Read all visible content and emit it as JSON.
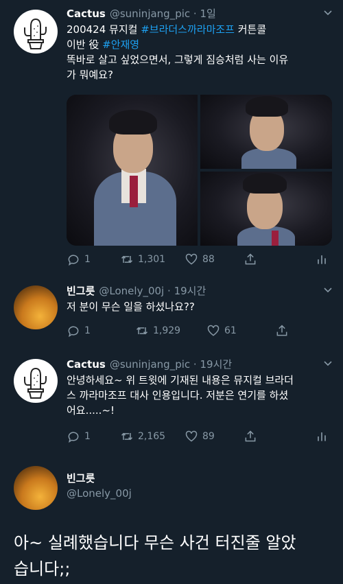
{
  "tweet1": {
    "name": "Cactus",
    "handle": "@suninjang_pic",
    "dot": "·",
    "time": "1일",
    "line1_pre": "200424 뮤지컬 ",
    "line1_tag": "#브라더스까라마조프",
    "line1_post": " 커튼콜",
    "line2_pre": "이반 役 ",
    "line2_tag": "#안재영",
    "line3": "똑바로 살고 싶었으면서, 그렇게 짐승처럼 사는 이유",
    "line4": "가 뭐예요?",
    "reply_count": "1",
    "retweet_count": "1,301",
    "like_count": "88"
  },
  "tweet2": {
    "name": "빈그릇",
    "handle": "@Lonely_00j",
    "dot": "·",
    "time": "19시간",
    "text": "저 분이 무슨 일을 하셨나요??",
    "reply_count": "1",
    "retweet_count": "1,929",
    "like_count": "61"
  },
  "tweet3": {
    "name": "Cactus",
    "handle": "@suninjang_pic",
    "dot": "·",
    "time": "19시간",
    "line1": "안녕하세요~ 위 트윗에 기재된 내용은 뮤지컬 브라더",
    "line2": "스 까라마조프 대사 인용입니다. 저분은 연기를 하셨",
    "line3": "어요.....~!",
    "reply_count": "1",
    "retweet_count": "2,165",
    "like_count": "89"
  },
  "tweet4": {
    "name": "빈그릇",
    "handle": "@Lonely_00j",
    "text_line1": "아~ 실례했습니다 무슨 사건 터진줄 알았",
    "text_line2": "습니다;;"
  },
  "icons": {
    "reply": "reply-icon",
    "retweet": "retweet-icon",
    "like": "heart-icon",
    "share": "share-icon",
    "analytics": "analytics-icon",
    "more": "chevron-down-icon"
  },
  "colors": {
    "background": "#15202b",
    "text": "#ffffff",
    "muted": "#8899a6",
    "hashtag": "#1da1f2"
  }
}
